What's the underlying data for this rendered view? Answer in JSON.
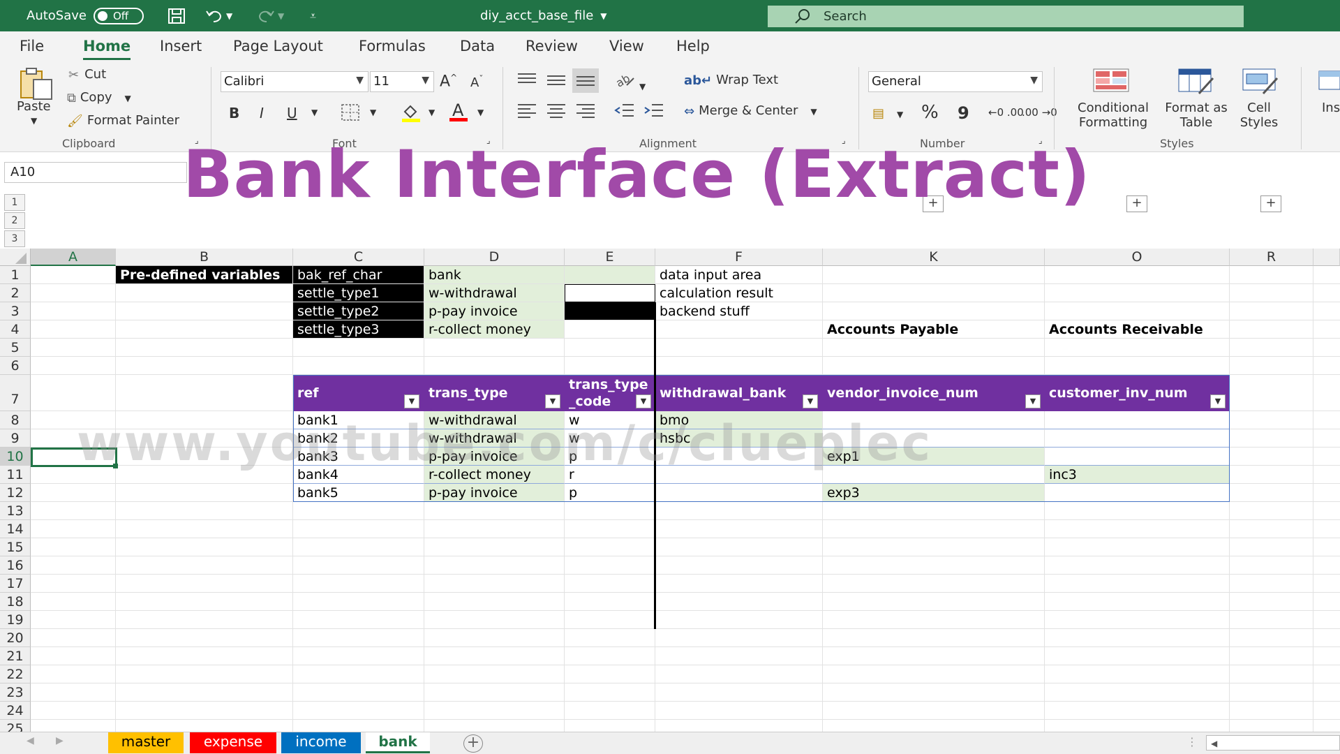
{
  "title_bar": {
    "autosave_label": "AutoSave",
    "autosave_state": "Off",
    "filename": "diy_acct_base_file",
    "search_placeholder": "Search"
  },
  "ribbon_tabs": [
    "File",
    "Home",
    "Insert",
    "Page Layout",
    "Formulas",
    "Data",
    "Review",
    "View",
    "Help"
  ],
  "active_tab": "Home",
  "ribbon": {
    "clipboard": {
      "paste": "Paste",
      "cut": "Cut",
      "copy": "Copy",
      "format_painter": "Format Painter",
      "group": "Clipboard"
    },
    "font": {
      "family": "Calibri",
      "size": "11",
      "bold": "B",
      "italic": "I",
      "underline": "U",
      "group": "Font"
    },
    "alignment": {
      "wrap_text": "Wrap Text",
      "merge_center": "Merge & Center",
      "group": "Alignment"
    },
    "number": {
      "format": "General",
      "percent": "%",
      "comma": "9",
      "inc_decimal": "←0 .00",
      "dec_decimal": ".00 →0",
      "group": "Number"
    },
    "styles": {
      "conditional": "Conditional Formatting",
      "format_table": "Format as Table",
      "cell_styles": "Cell Styles",
      "group": "Styles"
    },
    "insert_partial": "Ins"
  },
  "name_box": "A10",
  "banner": "Bank Interface (Extract)",
  "outline_levels": [
    "1",
    "2",
    "3"
  ],
  "columns": [
    "A",
    "B",
    "C",
    "D",
    "E",
    "F",
    "K",
    "O",
    "R"
  ],
  "rows": [
    "1",
    "2",
    "3",
    "4",
    "5",
    "6",
    "7",
    "8",
    "9",
    "10",
    "11",
    "12",
    "13",
    "14",
    "15",
    "16",
    "17",
    "18",
    "19",
    "20",
    "21",
    "22",
    "23",
    "24",
    "25"
  ],
  "cells": {
    "B1": "Pre-defined variables",
    "C1": "bak_ref_char",
    "D1": "bank",
    "C2": "settle_type1",
    "D2": "w-withdrawal",
    "C3": "settle_type2",
    "D3": "p-pay invoice",
    "C4": "settle_type3",
    "D4": "r-collect money",
    "F1": "data input area",
    "F2": "calculation result",
    "F3": "backend stuff",
    "K4": "Accounts Payable",
    "O4": "Accounts Receivable"
  },
  "table": {
    "headers": [
      "ref",
      "trans_type",
      "trans_type\n_code",
      "withdrawal_bank",
      "vendor_invoice_num",
      "customer_inv_num"
    ],
    "rows": [
      [
        "bank1",
        "w-withdrawal",
        "w",
        "bmo",
        "",
        ""
      ],
      [
        "bank2",
        "w-withdrawal",
        "w",
        "hsbc",
        "",
        ""
      ],
      [
        "bank3",
        "p-pay invoice",
        "p",
        "",
        "exp1",
        ""
      ],
      [
        "bank4",
        "r-collect money",
        "r",
        "",
        "",
        "inc3"
      ],
      [
        "bank5",
        "p-pay invoice",
        "p",
        "",
        "exp3",
        ""
      ]
    ]
  },
  "watermark": "www.youtube.com/c/clueplec",
  "sheets": [
    {
      "name": "master",
      "color": "#ffc000",
      "text": "#000000"
    },
    {
      "name": "expense",
      "color": "#ff0000",
      "text": "#ffffff"
    },
    {
      "name": "income",
      "color": "#0070c0",
      "text": "#ffffff"
    },
    {
      "name": "bank",
      "color": "#ffffff",
      "text": "#217346"
    }
  ],
  "colors": {
    "excel_green": "#217346",
    "header_purple": "#7030a0",
    "input_green": "#e2efda",
    "banner_purple": "#a14aa8"
  }
}
